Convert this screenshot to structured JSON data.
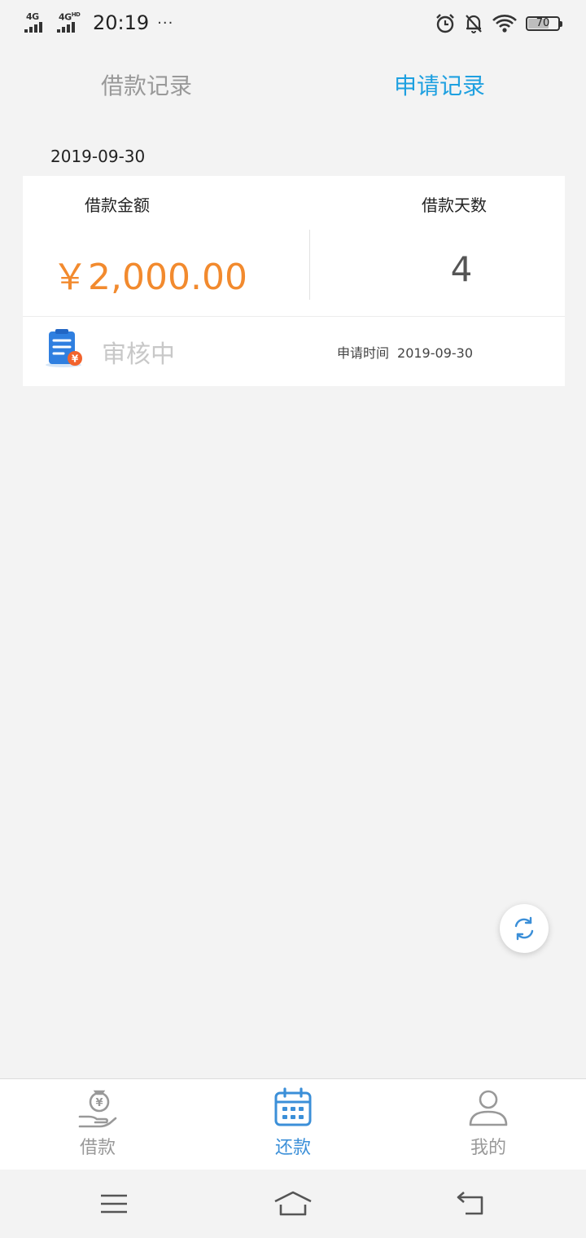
{
  "status_bar": {
    "network1": "4G",
    "network2": "4G",
    "network2_sup": "HD",
    "time": "20:19",
    "more": "···",
    "battery_percent": "70",
    "battery_level": 0.7,
    "icons": [
      "alarm-icon",
      "bell-off-icon",
      "wifi-icon",
      "battery-icon"
    ]
  },
  "tabs": [
    {
      "label": "借款记录",
      "active": false
    },
    {
      "label": "申请记录",
      "active": true
    }
  ],
  "record": {
    "date": "2019-09-30",
    "amount_label": "借款金额",
    "days_label": "借款天数",
    "amount": "￥2,000.00",
    "days": "4",
    "status": "审核中",
    "apply_time_label": "申请时间",
    "apply_time": "2019-09-30"
  },
  "bottom_nav": [
    {
      "label": "借款",
      "icon": "money-bag-hand-icon",
      "active": false
    },
    {
      "label": "还款",
      "icon": "calendar-icon",
      "active": true
    },
    {
      "label": "我的",
      "icon": "user-icon",
      "active": false
    }
  ],
  "colors": {
    "accent": "#1ea0e0",
    "amount": "#f28a2e",
    "nav_active": "#3b8fd8",
    "inactive": "#999999"
  }
}
